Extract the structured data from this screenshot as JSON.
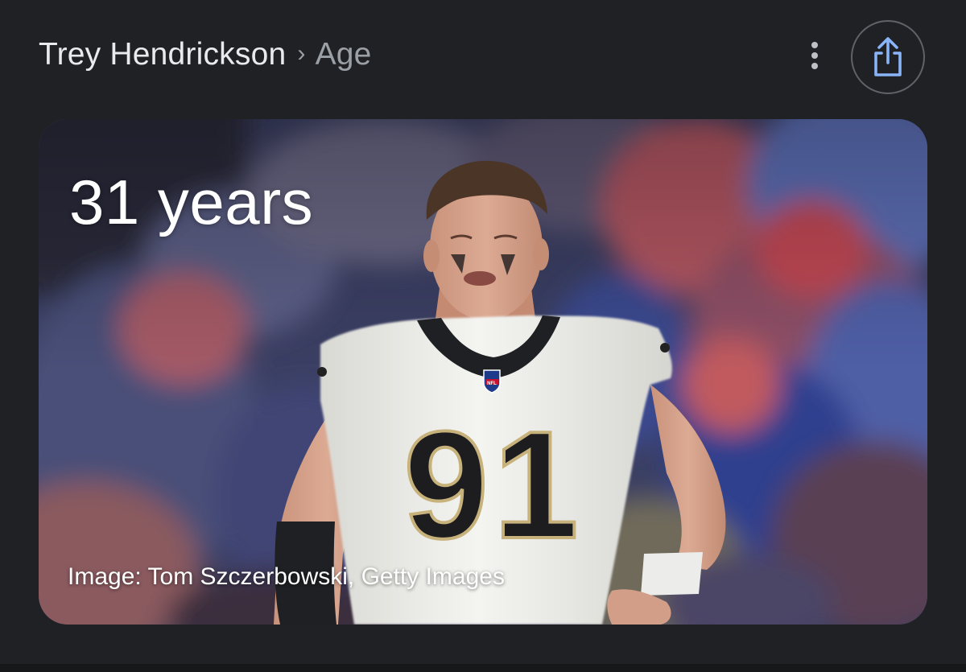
{
  "header": {
    "entity": "Trey Hendrickson",
    "separator": "›",
    "attribute": "Age"
  },
  "actions": {
    "more_icon": "more-vert-icon",
    "share_icon": "share-icon"
  },
  "card": {
    "answer": "31 years",
    "image_credit": "Image: Tom Szczerbowski, Getty Images",
    "jersey_number": "91",
    "shield_text": "NFL"
  },
  "colors": {
    "background": "#202124",
    "share_accent": "#8ab4f8",
    "jersey": "#eeeeea",
    "jersey_trim": "#c8b27b",
    "collar": "#1f2024"
  }
}
